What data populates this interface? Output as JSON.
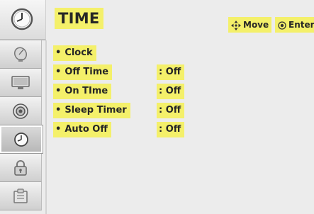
{
  "header": {
    "title": "TIME",
    "move_hint": "Move",
    "enter_hint": "Enter"
  },
  "sidebar": {
    "items": [
      {
        "icon": "satellite-dish-icon",
        "active": false
      },
      {
        "icon": "monitor-icon",
        "active": false
      },
      {
        "icon": "speaker-icon",
        "active": false
      },
      {
        "icon": "clock-icon",
        "active": true
      },
      {
        "icon": "lock-icon",
        "active": false
      },
      {
        "icon": "options-icon",
        "active": false
      }
    ]
  },
  "menu": {
    "items": [
      {
        "label": "Clock",
        "value": ""
      },
      {
        "label": "Off Time",
        "value": ": Off"
      },
      {
        "label": "On TIme",
        "value": ": Off"
      },
      {
        "label": "Sleep Timer",
        "value": ": Off"
      },
      {
        "label": "Auto Off",
        "value": ": Off"
      }
    ]
  },
  "colors": {
    "highlight": "#f4f06a",
    "background": "#ececec",
    "text": "#262626"
  }
}
